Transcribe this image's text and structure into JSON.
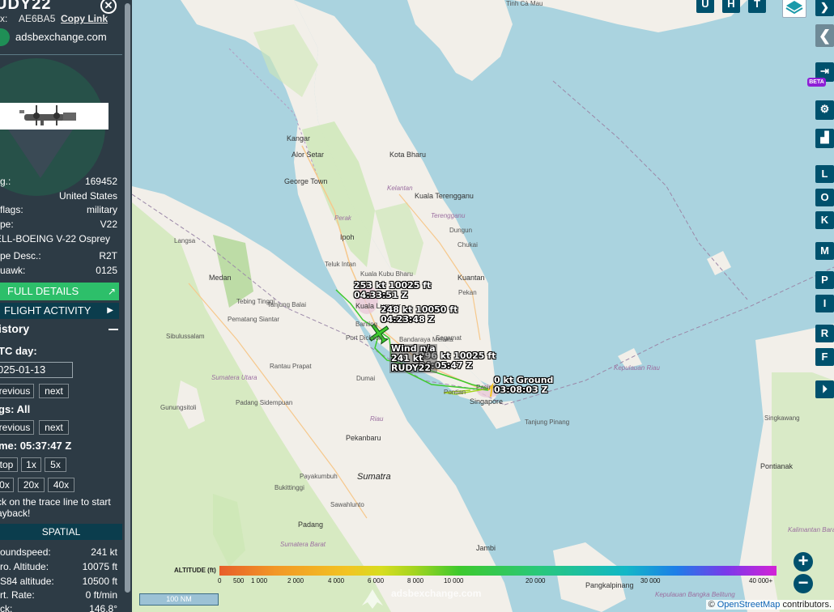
{
  "aircraft": {
    "callsign": "UDY22",
    "hex_label": "x:",
    "hex": "AE6BA5",
    "copy_link": "Copy Link",
    "close": "✕",
    "source_site": "adsbexchange.com"
  },
  "details": [
    {
      "key": "g.:",
      "value": "169452"
    },
    {
      "key": "",
      "value": "United States"
    },
    {
      "key": "flags:",
      "value": "military"
    },
    {
      "key": "pe:",
      "value": "V22"
    },
    {
      "key": "ELL-BOEING V-22 Osprey",
      "value": ""
    },
    {
      "key": "pe Desc.:",
      "value": "R2T"
    },
    {
      "key": "uawk:",
      "value": "0125"
    }
  ],
  "buttons": {
    "full_details": "FULL DETAILS",
    "flight_activity": "FLIGHT ACTIVITY"
  },
  "history": {
    "title": "istory",
    "utc_day_label": "TC day:",
    "date": "025-01-13",
    "previous": "revious",
    "next": "next",
    "flags_label": "gs: All",
    "time_label": "me: 05:37:47 Z",
    "speeds": [
      "top",
      "1x",
      "5x",
      "0x",
      "20x",
      "40x"
    ],
    "hint": "ck on the trace line to start ayback!"
  },
  "spatial": {
    "title": "SPATIAL",
    "rows": [
      {
        "key": "oundspeed:",
        "value": "241 kt"
      },
      {
        "key": "ro. Altitude:",
        "value": "10075 ft"
      },
      {
        "key": "S84 altitude:",
        "value": "10500 ft"
      },
      {
        "key": "rt. Rate:",
        "value": "0 ft/min"
      },
      {
        "key": "ck:",
        "value": "146.8°"
      }
    ]
  },
  "map": {
    "trace_labels": [
      {
        "line1": "253 kt  10025 ft",
        "line2": "04:33:51 Z"
      },
      {
        "line1": "248 kt  10050 ft",
        "line2": "04:23:48 Z"
      },
      {
        "line1": "296 kt  10025 ft",
        "line2": "04:05:47 Z"
      },
      {
        "line1": "0 kt  Ground",
        "line2": "03:08:03 Z"
      }
    ],
    "selected_label": {
      "line1": "Wind n/a",
      "line2": "241 kt",
      "line3": "RUDY22"
    },
    "places": [
      {
        "name": "Tinh Cà Mau",
        "cls": ""
      },
      {
        "name": "Kangar",
        "cls": "city"
      },
      {
        "name": "Alor Setar",
        "cls": "city"
      },
      {
        "name": "Kota Bharu",
        "cls": "city"
      },
      {
        "name": "George Town",
        "cls": "city"
      },
      {
        "name": "Kelantan",
        "cls": "region"
      },
      {
        "name": "Kuala Terengganu",
        "cls": "city"
      },
      {
        "name": "Perak",
        "cls": "region"
      },
      {
        "name": "Terengganu",
        "cls": "region"
      },
      {
        "name": "Ipoh",
        "cls": "city"
      },
      {
        "name": "Dungun",
        "cls": ""
      },
      {
        "name": "Chukai",
        "cls": ""
      },
      {
        "name": "Langsa",
        "cls": ""
      },
      {
        "name": "Teluk Intan",
        "cls": ""
      },
      {
        "name": "Kuantan",
        "cls": "city"
      },
      {
        "name": "Medan",
        "cls": "city"
      },
      {
        "name": "Kuala Kubu Bharu",
        "cls": ""
      },
      {
        "name": "Pekan",
        "cls": ""
      },
      {
        "name": "Tebing Tinggi",
        "cls": ""
      },
      {
        "name": "Tanjung Balai",
        "cls": ""
      },
      {
        "name": "Pematang Siantar",
        "cls": ""
      },
      {
        "name": "Sibulussalam",
        "cls": ""
      },
      {
        "name": "Banting",
        "cls": ""
      },
      {
        "name": "Port Dickson",
        "cls": ""
      },
      {
        "name": "Bandaraya Melaka",
        "cls": ""
      },
      {
        "name": "Segamat",
        "cls": ""
      },
      {
        "name": "Kepulauan Riau",
        "cls": "region"
      },
      {
        "name": "Rantau Prapat",
        "cls": ""
      },
      {
        "name": "Sumatera Utara",
        "cls": "region"
      },
      {
        "name": "Dumai",
        "cls": ""
      },
      {
        "name": "Pontian",
        "cls": ""
      },
      {
        "name": "Singapore",
        "cls": "city"
      },
      {
        "name": "Padang Sidempuan",
        "cls": ""
      },
      {
        "name": "Gunungsitoli",
        "cls": ""
      },
      {
        "name": "Tanjung Pinang",
        "cls": ""
      },
      {
        "name": "Singkawang",
        "cls": ""
      },
      {
        "name": "Riau",
        "cls": "region"
      },
      {
        "name": "Pekanbaru",
        "cls": "city"
      },
      {
        "name": "Sumatra",
        "cls": "big"
      },
      {
        "name": "Payakumbuh",
        "cls": ""
      },
      {
        "name": "Bukittinggi",
        "cls": ""
      },
      {
        "name": "Sawahlunto",
        "cls": ""
      },
      {
        "name": "Padang",
        "cls": "city"
      },
      {
        "name": "Sumatera Barat",
        "cls": "region"
      },
      {
        "name": "Pontianak",
        "cls": "city"
      },
      {
        "name": "Jambi",
        "cls": "city"
      },
      {
        "name": "Kalimantan Barat",
        "cls": "region"
      },
      {
        "name": "Pangkalpinang",
        "cls": "city"
      },
      {
        "name": "Kepulauan Bangka Belitung",
        "cls": "region"
      },
      {
        "name": "Kuala Lumpur",
        "cls": "city"
      },
      {
        "name": "Pasir Gudang",
        "cls": ""
      }
    ],
    "toolbar_letters": [
      "U",
      "H",
      "T"
    ],
    "side_letters": [
      "L",
      "O",
      "K",
      "M",
      "P",
      "I",
      "R",
      "F"
    ],
    "beta": "BETA",
    "zoom_in": "+",
    "zoom_out": "−",
    "altitude_title": "ALTITUDE (ft)",
    "altitude_ticks": [
      "0",
      "500",
      "1 000",
      "2 000",
      "4 000",
      "6 000",
      "8 000",
      "10 000",
      "20 000",
      "30 000",
      "40 000+"
    ],
    "scale": "100 NM",
    "watermark": "adsbexchange.com",
    "attribution_prefix": "©",
    "attribution_link": "OpenStreetMap",
    "attribution_suffix": "contributors."
  },
  "colors": {
    "sidebar_bg": "#2d3b45",
    "accent_green": "#2dbf6a",
    "button_dark": "#0b3d4d",
    "map_water": "#aad3df",
    "map_land": "#f2efe9",
    "trace_green": "#3ec92d",
    "trace_yellow": "#f2c422"
  }
}
